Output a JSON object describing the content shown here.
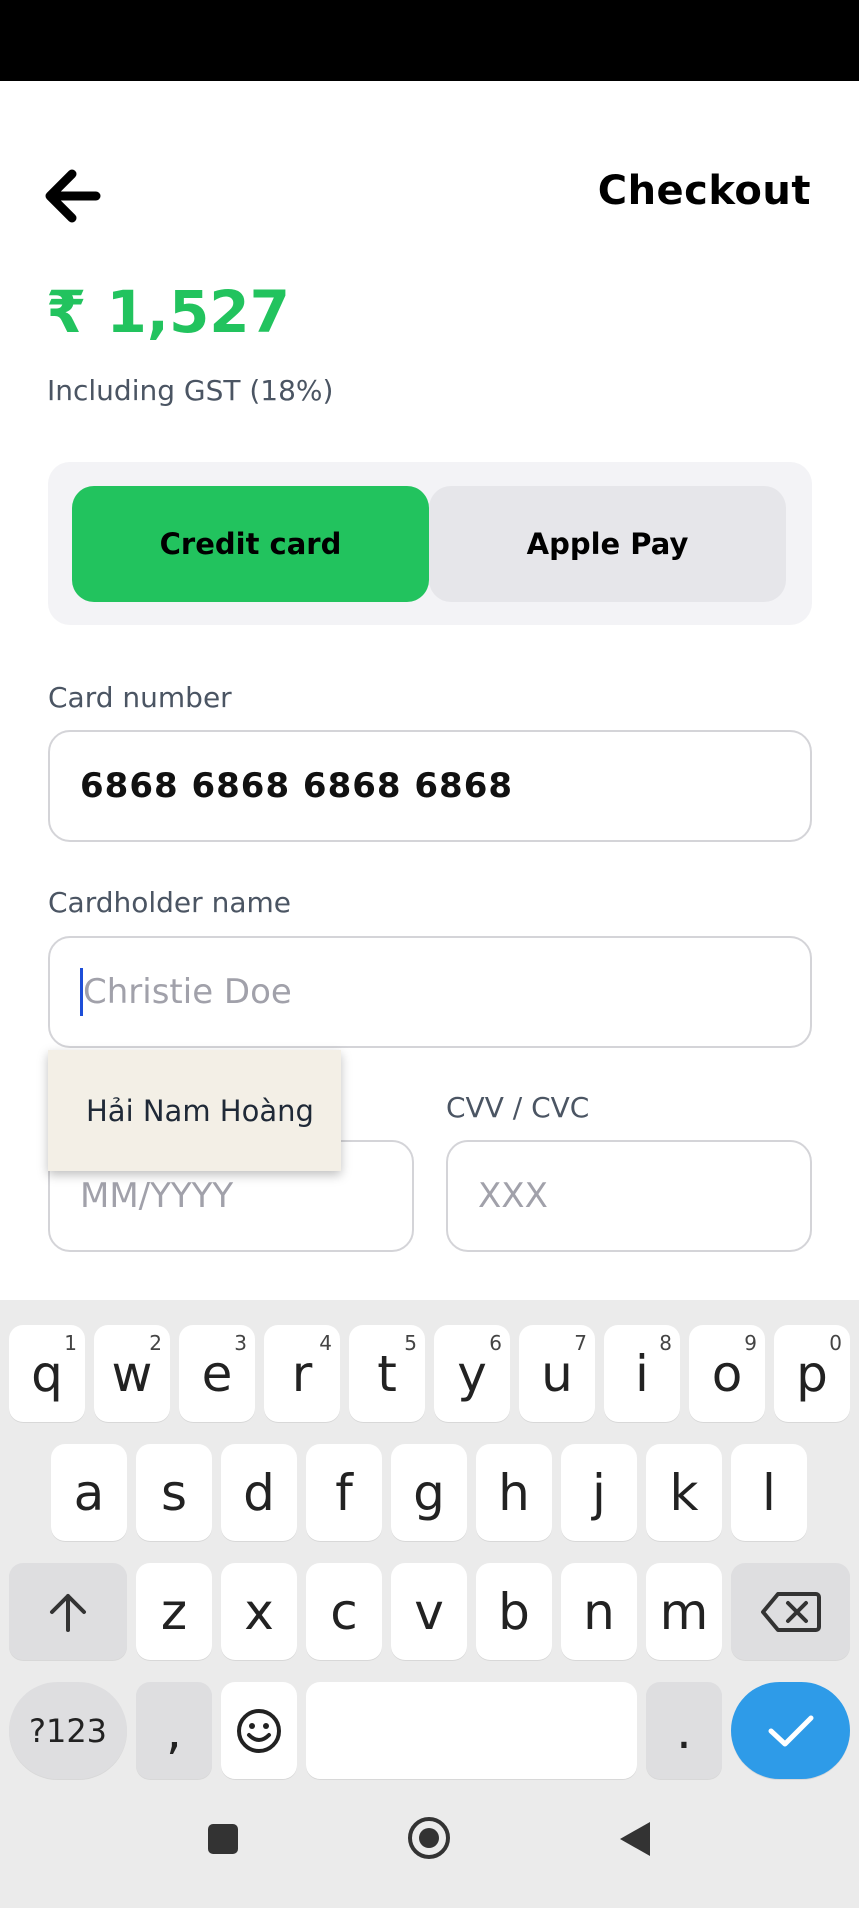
{
  "header": {
    "title": "Checkout"
  },
  "summary": {
    "amount": "₹ 1,527",
    "gst_note": "Including GST (18%)"
  },
  "payment_methods": {
    "credit_card_label": "Credit card",
    "apple_pay_label": "Apple Pay",
    "selected": "Credit card"
  },
  "form": {
    "card_number_label": "Card number",
    "card_number_value": "6868 6868 6868 6868",
    "cardholder_label": "Cardholder name",
    "cardholder_placeholder": "Christie Doe",
    "expiry_placeholder": "MM/YYYY",
    "cvv_label": "CVV / CVC",
    "cvv_placeholder": "XXX"
  },
  "autofill": {
    "suggestion": "Hải Nam Hoàng"
  },
  "keyboard": {
    "row1": [
      "q",
      "w",
      "e",
      "r",
      "t",
      "y",
      "u",
      "i",
      "o",
      "p"
    ],
    "row1_hints": [
      "1",
      "2",
      "3",
      "4",
      "5",
      "6",
      "7",
      "8",
      "9",
      "0"
    ],
    "row2": [
      "a",
      "s",
      "d",
      "f",
      "g",
      "h",
      "j",
      "k",
      "l"
    ],
    "row3": [
      "z",
      "x",
      "c",
      "v",
      "b",
      "n",
      "m"
    ],
    "symbols_label": "?123",
    "comma": ",",
    "period": "."
  },
  "colors": {
    "accent": "#22c35e",
    "done_key": "#2e9be8",
    "autofill_bg": "#f3efe6"
  },
  "icons": {
    "back": "back-arrow-icon",
    "shift": "shift-arrow-icon",
    "backspace": "backspace-icon",
    "emoji": "emoji-icon",
    "done": "checkmark-icon",
    "nav_recent": "square-icon",
    "nav_home": "circle-icon",
    "nav_back": "triangle-back-icon"
  }
}
